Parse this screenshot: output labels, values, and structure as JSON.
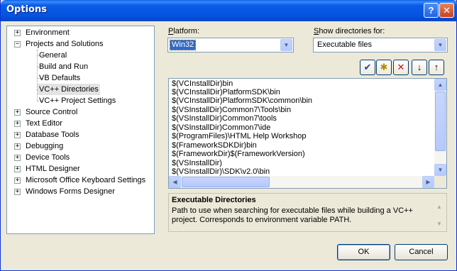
{
  "window": {
    "title": "Options"
  },
  "titlebar_buttons": {
    "help": "?",
    "close": "✕"
  },
  "tree": {
    "items": [
      {
        "label": "Environment",
        "expander": "+"
      },
      {
        "label": "Projects and Solutions",
        "expander": "−"
      },
      {
        "label": "General"
      },
      {
        "label": "Build and Run"
      },
      {
        "label": "VB Defaults"
      },
      {
        "label": "VC++ Directories",
        "selected": true
      },
      {
        "label": "VC++ Project Settings"
      },
      {
        "label": "Source Control",
        "expander": "+"
      },
      {
        "label": "Text Editor",
        "expander": "+"
      },
      {
        "label": "Database Tools",
        "expander": "+"
      },
      {
        "label": "Debugging",
        "expander": "+"
      },
      {
        "label": "Device Tools",
        "expander": "+"
      },
      {
        "label": "HTML Designer",
        "expander": "+"
      },
      {
        "label": "Microsoft Office Keyboard Settings",
        "expander": "+"
      },
      {
        "label": "Windows Forms Designer",
        "expander": "+"
      }
    ]
  },
  "platform": {
    "label_accel": "P",
    "label_rest": "latform:",
    "value": "Win32"
  },
  "show_dirs": {
    "label_accel": "S",
    "label_rest": "how directories for:",
    "value": "Executable files"
  },
  "toolbar": {
    "check": "✔",
    "new_line": "✱",
    "delete": "✕",
    "move_down": "↓",
    "move_up": "↑"
  },
  "directories": [
    "$(VCInstallDir)bin",
    "$(VCInstallDir)PlatformSDK\\bin",
    "$(VCInstallDir)PlatformSDK\\common\\bin",
    "$(VSInstallDir)Common7\\Tools\\bin",
    "$(VSInstallDir)Common7\\tools",
    "$(VSInstallDir)Common7\\ide",
    "$(ProgramFiles)\\HTML Help Workshop",
    "$(FrameworkSDKDir)bin",
    "$(FrameworkDir)$(FrameworkVersion)",
    "$(VSInstallDir)",
    "$(VSInstallDir)\\SDK\\v2.0\\bin"
  ],
  "description": {
    "title": "Executable Directories",
    "text": "Path to use when searching for executable files while building a VC++ project.  Corresponds to environment variable PATH."
  },
  "buttons": {
    "ok": "OK",
    "cancel": "Cancel"
  }
}
